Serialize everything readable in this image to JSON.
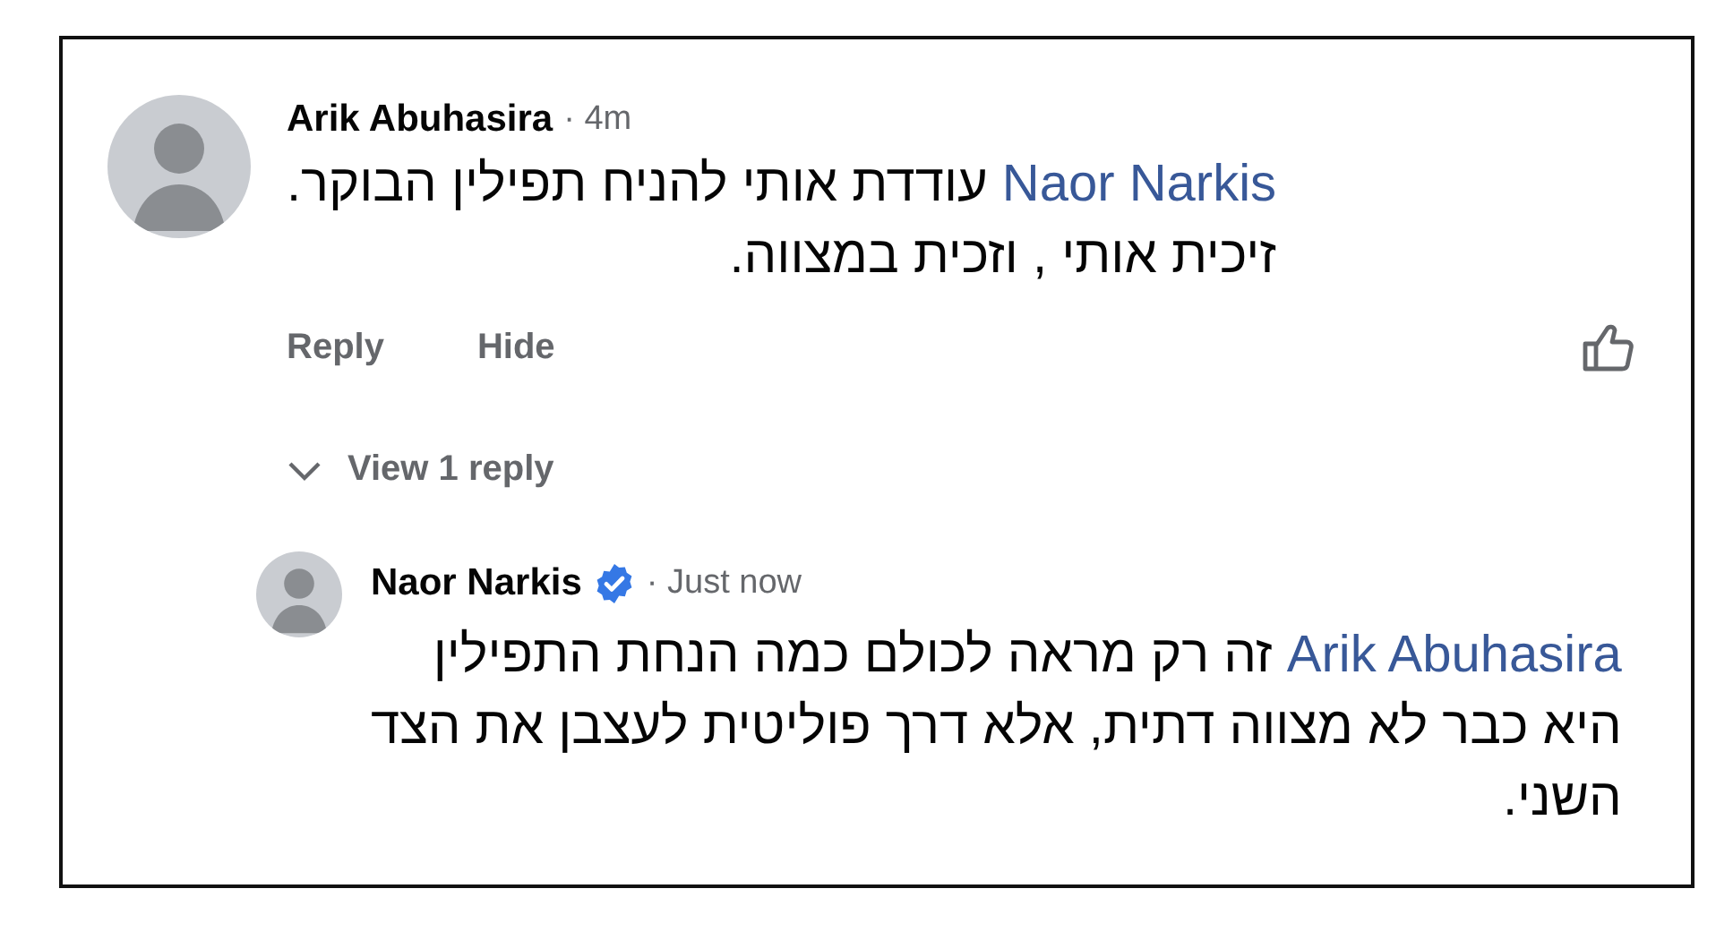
{
  "comments": [
    {
      "author": "Arik Abuhasira",
      "time": "· 4m",
      "mention": "Naor Narkis",
      "text": "עודדת אותי להניח תפילין הבוקר.\nזיכית אותי , וזכית במצווה.",
      "reply_action": "Reply",
      "hide_action": "Hide",
      "replies_toggle": "View 1 reply",
      "replies": [
        {
          "author": "Naor Narkis",
          "verified": true,
          "time": "· Just now",
          "mention": "Arik Abuhasira",
          "text": "זה רק מראה לכולם כמה הנחת התפילין\nהיא כבר לא מצווה דתית, אלא דרך פוליטית לעצבן את הצד\nהשני."
        }
      ]
    }
  ]
}
